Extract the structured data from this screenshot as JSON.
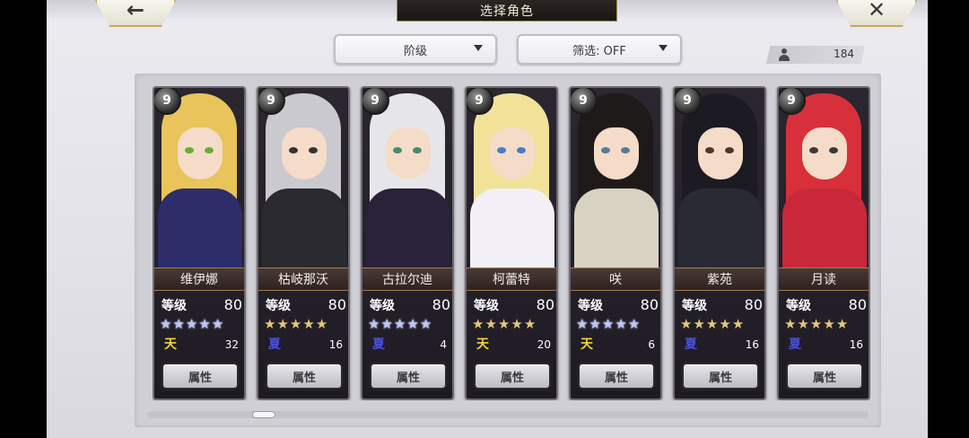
{
  "header": {
    "title": "选择角色",
    "back_icon": "←",
    "close_icon": "✕"
  },
  "filters": {
    "rank_label": "阶级",
    "filter_label": "筛选: OFF"
  },
  "owned_count": "184",
  "level_label": "等级",
  "attr_button_label": "属性",
  "rank_badge": "9",
  "scroll_position": 0.15,
  "characters": [
    {
      "name": "维伊娜",
      "level": "80",
      "stars": 5,
      "star_color": "blue",
      "element_glyph": "天",
      "element": "heaven",
      "count": "32",
      "hair": "#e8c45a",
      "eye": "#6da83a",
      "cloth": "#2d2d6a"
    },
    {
      "name": "枯岐那沃",
      "level": "80",
      "stars": 5,
      "star_color": "gold",
      "element_glyph": "夏",
      "element": "summer",
      "count": "16",
      "hair": "#c9c9cf",
      "eye": "#333333",
      "cloth": "#2a2a30"
    },
    {
      "name": "古拉尔迪",
      "level": "80",
      "stars": 5,
      "star_color": "blue",
      "element_glyph": "夏",
      "element": "summer",
      "count": "4",
      "hair": "#e6e6ea",
      "eye": "#4a8a6a",
      "cloth": "#2a2238"
    },
    {
      "name": "柯蕾特",
      "level": "80",
      "stars": 5,
      "star_color": "gold",
      "element_glyph": "天",
      "element": "heaven",
      "count": "20",
      "hair": "#f1e29a",
      "eye": "#4a7ac8",
      "cloth": "#f2f0f6"
    },
    {
      "name": "咲",
      "level": "80",
      "stars": 5,
      "star_color": "blue",
      "element_glyph": "天",
      "element": "heaven",
      "count": "6",
      "hair": "#1f1a1a",
      "eye": "#5a7a9a",
      "cloth": "#d8d2c2"
    },
    {
      "name": "紫苑",
      "level": "80",
      "stars": 5,
      "star_color": "gold",
      "element_glyph": "夏",
      "element": "summer",
      "count": "16",
      "hair": "#1c1a22",
      "eye": "#4a3a2a",
      "cloth": "#2a2a34"
    },
    {
      "name": "月读",
      "level": "80",
      "stars": 5,
      "star_color": "gold",
      "element_glyph": "夏",
      "element": "summer",
      "count": "16",
      "hair": "#d8303a",
      "eye": "#3a3a3a",
      "cloth": "#c8283a"
    }
  ]
}
